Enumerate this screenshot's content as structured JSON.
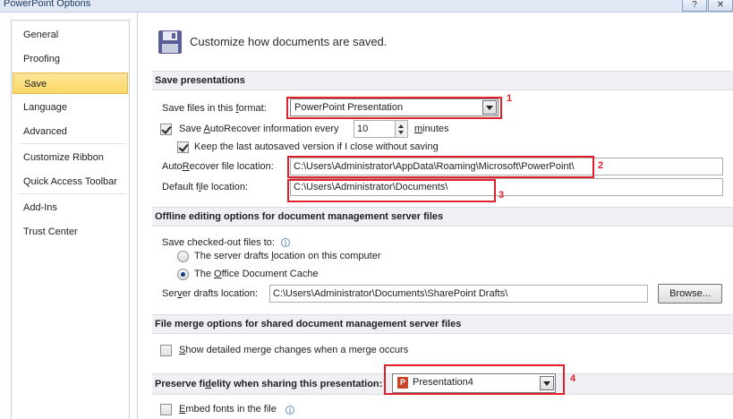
{
  "window": {
    "title": "PowerPoint Options",
    "help_button": "?",
    "close_button": "✕"
  },
  "sidebar": {
    "items": [
      {
        "label": "General"
      },
      {
        "label": "Proofing"
      },
      {
        "label": "Save",
        "active": true
      },
      {
        "label": "Language"
      },
      {
        "label": "Advanced"
      },
      {
        "label": "Customize Ribbon"
      },
      {
        "label": "Quick Access Toolbar"
      },
      {
        "label": "Add-Ins"
      },
      {
        "label": "Trust Center"
      }
    ]
  },
  "header": {
    "text": "Customize how documents are saved.",
    "icon": "floppy-disk-icon"
  },
  "save_presentations": {
    "section_title": "Save presentations",
    "format_label_pre": "Save files in this ",
    "format_label_u": "f",
    "format_label_post": "ormat:",
    "format_value": "PowerPoint Presentation",
    "autorecover_pre": "Save ",
    "autorecover_u": "A",
    "autorecover_post": "utoRecover information every",
    "autorecover_checked": true,
    "autorecover_minutes": "10",
    "minutes_u": "m",
    "minutes_post": "inutes",
    "keep_last": "Keep the last autosaved version if I close without saving",
    "keep_last_checked": true,
    "autorecover_loc_pre": "Auto",
    "autorecover_loc_u": "R",
    "autorecover_loc_post": "ecover file location:",
    "autorecover_loc_value": "C:\\Users\\Administrator\\AppData\\Roaming\\Microsoft\\PowerPoint\\",
    "default_loc_pre": "Default f",
    "default_loc_u": "i",
    "default_loc_post": "le location:",
    "default_loc_value": "C:\\Users\\Administrator\\Documents\\"
  },
  "offline": {
    "section_title": "Offline editing options for document management server files",
    "save_checked_out": "Save checked-out files to:",
    "server_drafts_pre": "The server drafts ",
    "server_drafts_u": "l",
    "server_drafts_post": "ocation on this computer",
    "server_drafts_checked": false,
    "office_cache_pre": "The ",
    "office_cache_u": "O",
    "office_cache_post": "ffice Document Cache",
    "office_cache_checked": true,
    "server_drafts_loc_pre": "Ser",
    "server_drafts_loc_u": "v",
    "server_drafts_loc_post": "er drafts location:",
    "server_drafts_loc_value": "C:\\Users\\Administrator\\Documents\\SharePoint Drafts\\",
    "browse_label": "Browse..."
  },
  "file_merge": {
    "section_title": "File merge options for shared document management server files",
    "show_merge_pre": "",
    "show_merge_u": "S",
    "show_merge_post": "how detailed merge changes when a merge occurs",
    "show_merge_checked": false
  },
  "fidelity": {
    "section_title_pre": "Preserve fi",
    "section_title_u": "d",
    "section_title_post": "elity when sharing this presentation:",
    "presentation_value": "Presentation4",
    "ppt_icon_glyph": "P",
    "embed_fonts_pre": "",
    "embed_fonts_u": "E",
    "embed_fonts_post": "mbed fonts in the file",
    "embed_fonts_checked": false
  },
  "annotations": {
    "marker_1": "1",
    "marker_2": "2",
    "marker_3": "3",
    "marker_4": "4",
    "color": "#e0202a"
  }
}
